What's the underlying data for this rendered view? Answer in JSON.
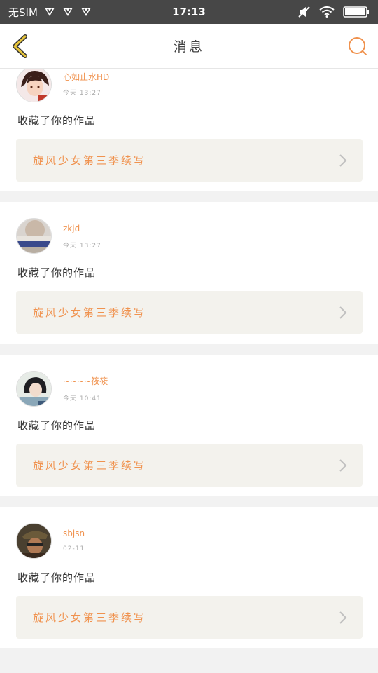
{
  "status_bar": {
    "carrier": "无SIM",
    "time": "17:13"
  },
  "header": {
    "title": "消息",
    "back_icon": "back-arrow-icon",
    "search_icon": "search-icon"
  },
  "colors": {
    "accent": "#f0924e",
    "back_arrow": "#e8c53a",
    "card_link_bg": "#f3f2ed"
  },
  "notifications": [
    {
      "user": "心如止水HD",
      "time": "今天 13:27",
      "action": "收藏了你的作品",
      "work": "旋风少女第三季续写"
    },
    {
      "user": "zkjd",
      "time": "今天 13:27",
      "action": "收藏了你的作品",
      "work": "旋风少女第三季续写"
    },
    {
      "user": "~~~~筱筱",
      "time": "今天 10:41",
      "action": "收藏了你的作品",
      "work": "旋风少女第三季续写"
    },
    {
      "user": "sbjsn",
      "time": "02-11",
      "action": "收藏了你的作品",
      "work": "旋风少女第三季续写"
    }
  ]
}
